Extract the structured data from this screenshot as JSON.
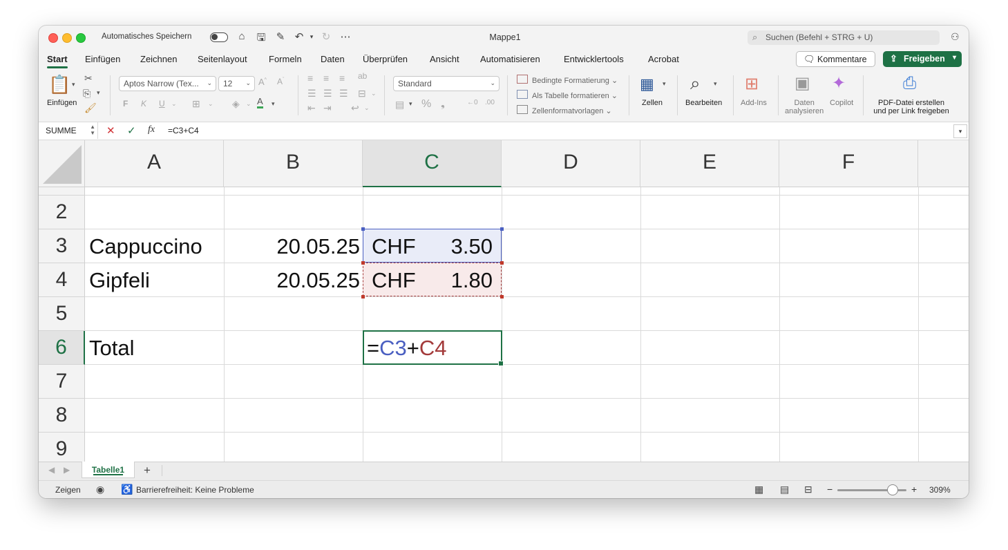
{
  "titlebar": {
    "autosave_label": "Automatisches Speichern",
    "document_title": "Mappe1",
    "search_placeholder": "Suchen (Befehl + STRG + U)"
  },
  "tabs": [
    {
      "label": "Start",
      "active": true
    },
    {
      "label": "Einfügen"
    },
    {
      "label": "Zeichnen"
    },
    {
      "label": "Seitenlayout"
    },
    {
      "label": "Formeln"
    },
    {
      "label": "Daten"
    },
    {
      "label": "Überprüfen"
    },
    {
      "label": "Ansicht"
    },
    {
      "label": "Automatisieren"
    },
    {
      "label": "Entwicklertools"
    },
    {
      "label": "Acrobat"
    }
  ],
  "actions": {
    "comments_label": "Kommentare",
    "share_label": "Freigeben"
  },
  "ribbon": {
    "paste_label": "Einfügen",
    "font_name": "Aptos Narrow (Tex...",
    "font_size": "12",
    "bold": "F",
    "italic": "K",
    "underline": "U",
    "number_format": "Standard",
    "conditional_formatting": "Bedingte Formatierung",
    "format_as_table": "Als Tabelle formatieren",
    "cell_styles": "Zellenformatvorlagen",
    "cells_label": "Zellen",
    "edit_label": "Bearbeiten",
    "addins_label": "Add-Ins",
    "analyze_label": "Daten\nanalysieren",
    "copilot_label": "Copilot",
    "pdf_label": "PDF-Datei erstellen\nund per Link freigeben"
  },
  "formula_bar": {
    "name_box": "SUMME",
    "fx": "fx",
    "formula": "=C3+C4"
  },
  "grid": {
    "columns": [
      "A",
      "B",
      "C",
      "D",
      "E",
      "F"
    ],
    "rows": [
      "2",
      "3",
      "4",
      "5",
      "6",
      "7",
      "8",
      "9"
    ],
    "cells": {
      "A3": "Cappuccino",
      "B3": "20.05.25",
      "C3_currency": "CHF",
      "C3_value": "3.50",
      "A4": "Gipfeli",
      "B4": "20.05.25",
      "C4_currency": "CHF",
      "C4_value": "1.80",
      "A6": "Total"
    },
    "edit_formula": {
      "eq": "=",
      "ref1": "C3",
      "plus": "+",
      "ref2": "C4"
    },
    "ref1_color": "#4a5fc1",
    "ref2_color": "#a33a3a"
  },
  "sheets": {
    "active": "Tabelle1",
    "add": "+"
  },
  "status": {
    "mode": "Zeigen",
    "accessibility": "Barrierefreiheit: Keine Probleme",
    "zoom_minus": "−",
    "zoom_plus": "+",
    "zoom": "309%"
  },
  "accent_color": "#1e7145"
}
